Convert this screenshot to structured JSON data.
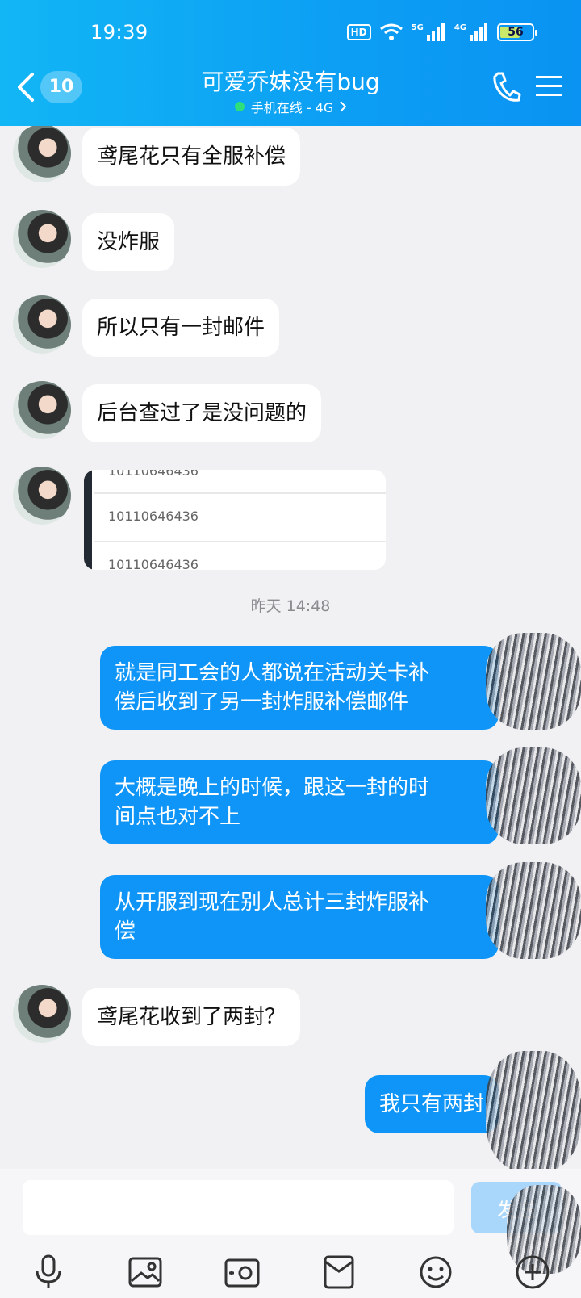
{
  "status_bar": {
    "time": "19:39",
    "hd_label": "HD",
    "net_5g": "5G",
    "net_4g": "4G",
    "battery": "56"
  },
  "header": {
    "back_count": "10",
    "title": "可爱乔妹没有bug",
    "subtitle": "手机在线 - 4G",
    "online_color": "#2fe07a"
  },
  "messages": [
    {
      "side": "in",
      "text": "鸢尾花只有全服补偿"
    },
    {
      "side": "in",
      "text": "没炸服"
    },
    {
      "side": "in",
      "text": "所以只有一封邮件"
    },
    {
      "side": "in",
      "text": "后台查过了是没问题的"
    },
    {
      "side": "in",
      "type": "image",
      "rows": [
        "10110646436",
        "10110646436",
        "10110646436"
      ]
    },
    {
      "type": "timestamp",
      "text": "昨天 14:48"
    },
    {
      "side": "out",
      "lines": [
        "就是同工会的人都说在活动关卡补",
        "偿后收到了另一封炸服补偿邮件"
      ]
    },
    {
      "side": "out",
      "lines": [
        "大概是晚上的时候，跟这一封的时",
        "间点也对不上"
      ]
    },
    {
      "side": "out",
      "lines": [
        "从开服到现在别人总计三封炸服补",
        "偿"
      ]
    },
    {
      "side": "in",
      "text": "鸢尾花收到了两封？"
    },
    {
      "side": "out",
      "lines": [
        "我只有两封"
      ]
    }
  ],
  "input": {
    "placeholder": "",
    "value": "",
    "send_label": "发送"
  },
  "toolbar": [
    "mic-icon",
    "image-icon",
    "camera-icon",
    "red-packet-icon",
    "emoji-icon",
    "plus-icon"
  ],
  "colors": {
    "header": "#0c9ef4",
    "bubble_out": "#0f95f7",
    "bubble_in": "#ffffff",
    "background": "#f1f1f3"
  }
}
